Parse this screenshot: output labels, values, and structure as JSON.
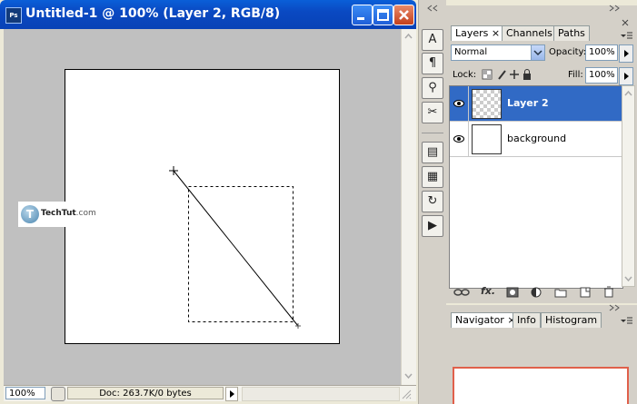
{
  "document": {
    "title": "Untitled-1 @ 100% (Layer 2, RGB/8)",
    "app_badge": "Ps",
    "zoom": "100%",
    "doc_info": "Doc: 263.7K/0 bytes"
  },
  "watermark": {
    "letter": "T",
    "brand": "TechTut",
    "suffix": ".com"
  },
  "tools": {
    "buttons": [
      "character-icon",
      "paragraph-icon",
      "clone-source-icon",
      "brush-settings-icon",
      "layer-comps-icon",
      "actions-icon",
      "history-icon",
      "animation-icon"
    ]
  },
  "layers_panel": {
    "tabs": [
      {
        "label": "Layers",
        "active": true,
        "close": "×"
      },
      {
        "label": "Channels",
        "active": false
      },
      {
        "label": "Paths",
        "active": false
      }
    ],
    "blend_mode": "Normal",
    "opacity_label": "Opacity:",
    "opacity_value": "100%",
    "lock_label": "Lock:",
    "fill_label": "Fill:",
    "fill_value": "100%",
    "layers": [
      {
        "name": "Layer 2",
        "selected": true,
        "visible": true
      },
      {
        "name": "background",
        "selected": false,
        "visible": true
      }
    ],
    "footer_icons": [
      "link-layers-icon",
      "fx-icon",
      "mask-icon",
      "adjustment-layer-icon",
      "group-icon",
      "new-layer-icon",
      "delete-layer-icon"
    ]
  },
  "navigator_panel": {
    "tabs": [
      {
        "label": "Navigator",
        "active": true,
        "close": "×"
      },
      {
        "label": "Info",
        "active": false
      },
      {
        "label": "Histogram",
        "active": false
      }
    ]
  },
  "colors": {
    "titlebar": "#0a56cf",
    "selection": "#316ac5",
    "canvas_bg": "#c0c0c0",
    "navigator_frame": "#e0604b"
  }
}
